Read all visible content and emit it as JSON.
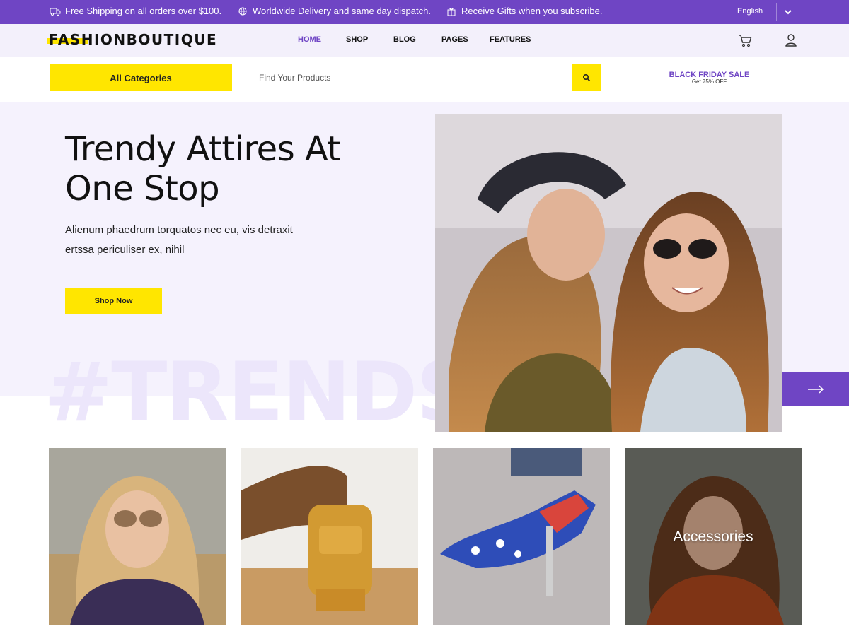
{
  "topbar": {
    "messages": [
      {
        "icon": "truck-icon",
        "text": "Free Shipping on all orders over $100."
      },
      {
        "icon": "globe-icon",
        "text": "Worldwide Delivery and same day dispatch."
      },
      {
        "icon": "gift-icon",
        "text": "Receive Gifts when you subscribe."
      }
    ],
    "language": "English"
  },
  "header": {
    "logo": "FASHIONBOUTIQUE",
    "nav": [
      {
        "label": "HOME",
        "active": true
      },
      {
        "label": "SHOP",
        "active": false
      },
      {
        "label": "BLOG",
        "active": false
      },
      {
        "label": "PAGES",
        "active": false
      },
      {
        "label": "FEATURES",
        "active": false
      }
    ],
    "icons": [
      "cart-icon",
      "user-icon"
    ]
  },
  "search": {
    "category_label": "All Categories",
    "placeholder": "Find Your Products",
    "promo_title": "BLACK FRIDAY SALE",
    "promo_subtitle": "Get 75% OFF"
  },
  "hero": {
    "title": "Trendy Attires At One Stop",
    "text": "Alienum phaedrum torquatos nec eu, vis detraxit ertssa periculiser ex, nihil",
    "button": "Shop Now",
    "watermark": "#TRENDS"
  },
  "categories": [
    {
      "label": ""
    },
    {
      "label": ""
    },
    {
      "label": ""
    },
    {
      "label": "Accessories"
    }
  ],
  "colors": {
    "accent": "#6f45c4",
    "highlight": "#ffe600",
    "hero_bg": "#f5f2fd"
  }
}
